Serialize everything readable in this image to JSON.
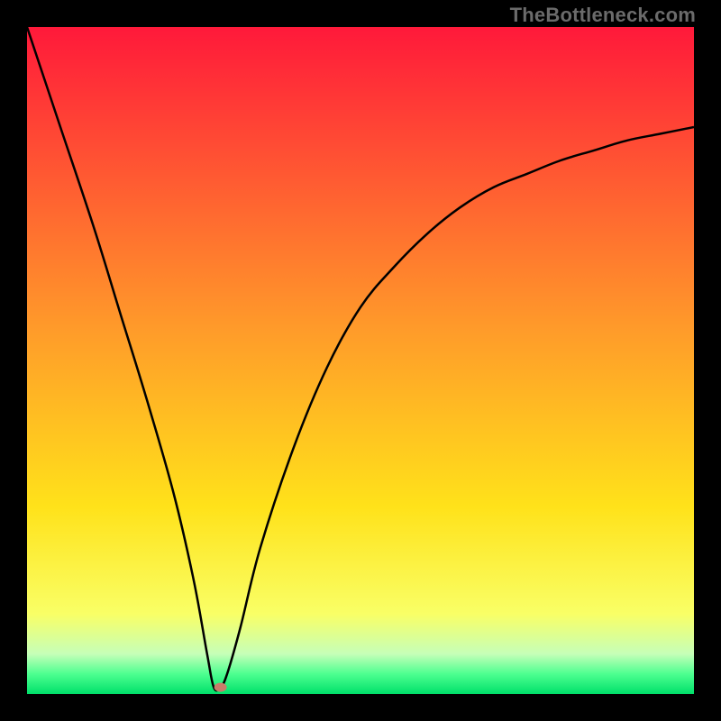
{
  "watermark": "TheBottleneck.com",
  "colors": {
    "top": "#ff193a",
    "upper_mid": "#ff7a2a",
    "mid": "#ffd21a",
    "lower_mid": "#f8ff5a",
    "pale_green": "#b8ffb0",
    "green": "#00e66a",
    "line": "#000000",
    "marker": "#c97c6a",
    "bg": "#000000"
  },
  "chart_data": {
    "type": "line",
    "title": "",
    "xlabel": "",
    "ylabel": "",
    "xlim": [
      0,
      100
    ],
    "ylim": [
      0,
      100
    ],
    "optimum_x": 28,
    "marker": {
      "x": 29,
      "y": 1
    },
    "series": [
      {
        "name": "bottleneck-curve",
        "x": [
          0,
          5,
          10,
          14,
          18,
          22,
          25,
          27,
          28,
          29,
          30,
          32,
          35,
          40,
          45,
          50,
          55,
          60,
          65,
          70,
          75,
          80,
          85,
          90,
          95,
          100
        ],
        "values": [
          100,
          85,
          70,
          57,
          44,
          30,
          17,
          6,
          1,
          1,
          3,
          10,
          22,
          37,
          49,
          58,
          64,
          69,
          73,
          76,
          78,
          80,
          81.5,
          83,
          84,
          85
        ]
      }
    ],
    "gradient_stops": [
      {
        "offset": 0,
        "color": "#ff193a"
      },
      {
        "offset": 0.45,
        "color": "#ff9a2a"
      },
      {
        "offset": 0.72,
        "color": "#ffe21a"
      },
      {
        "offset": 0.88,
        "color": "#f9ff66"
      },
      {
        "offset": 0.94,
        "color": "#c6ffb8"
      },
      {
        "offset": 0.97,
        "color": "#4dff90"
      },
      {
        "offset": 1,
        "color": "#00e06a"
      }
    ]
  }
}
